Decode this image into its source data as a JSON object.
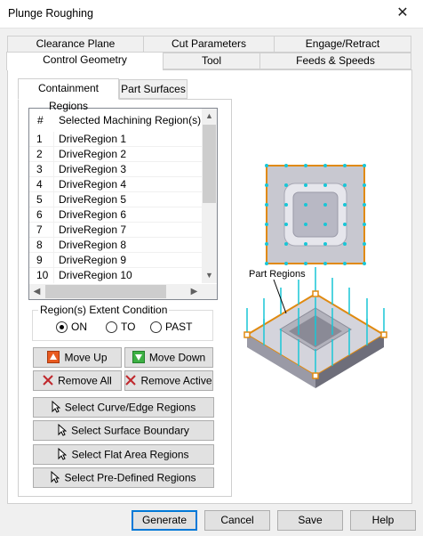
{
  "window": {
    "title": "Plunge Roughing",
    "close_glyph": "✕"
  },
  "tabs_back": [
    "Clearance Plane",
    "Cut Parameters",
    "Engage/Retract"
  ],
  "tabs_front": [
    "Control Geometry",
    "Tool",
    "Feeds & Speeds"
  ],
  "subtabs": [
    "Containment Regions",
    "Part Surfaces"
  ],
  "list": {
    "headers": [
      "#",
      "Selected Machining Region(s)"
    ],
    "rows": [
      [
        "1",
        "DriveRegion 1"
      ],
      [
        "2",
        "DriveRegion 2"
      ],
      [
        "3",
        "DriveRegion 3"
      ],
      [
        "4",
        "DriveRegion 4"
      ],
      [
        "5",
        "DriveRegion 5"
      ],
      [
        "6",
        "DriveRegion 6"
      ],
      [
        "7",
        "DriveRegion 7"
      ],
      [
        "8",
        "DriveRegion 8"
      ],
      [
        "9",
        "DriveRegion 9"
      ],
      [
        "10",
        "DriveRegion 10"
      ]
    ]
  },
  "extent": {
    "legend": "Region(s) Extent Condition",
    "options": [
      "ON",
      "TO",
      "PAST"
    ],
    "selected": "ON"
  },
  "buttons": {
    "move_up": "Move Up",
    "move_down": "Move Down",
    "remove_all": "Remove All",
    "remove_active": "Remove Active",
    "select_curve": "Select Curve/Edge Regions",
    "select_surface_boundary": "Select Surface Boundary",
    "select_flat": "Select Flat Area Regions",
    "select_predefined": "Select Pre-Defined Regions"
  },
  "illustration": {
    "label": "Part Regions"
  },
  "footer": {
    "generate": "Generate",
    "cancel": "Cancel",
    "save": "Save",
    "help": "Help"
  },
  "colors": {
    "accent": "#0078d7",
    "region_outline": "#e08a10",
    "points": "#19c6d6",
    "up_arrow": "#e85a20",
    "down_arrow": "#3cb043",
    "remove_x": "#c0282d"
  }
}
